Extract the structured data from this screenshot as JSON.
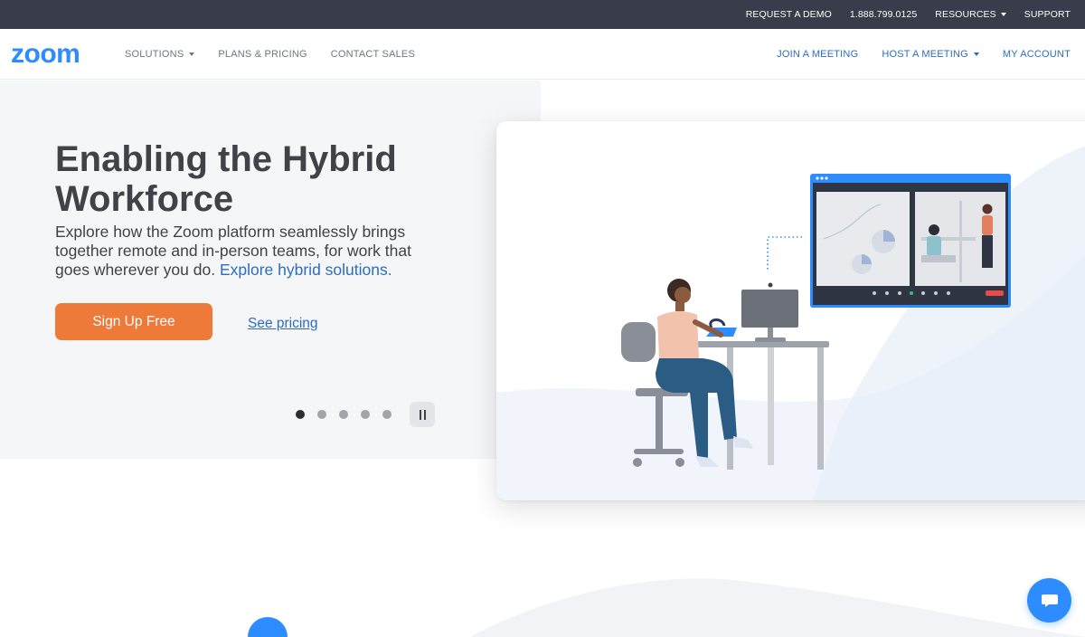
{
  "topbar": {
    "request_demo": "REQUEST A DEMO",
    "phone": "1.888.799.0125",
    "resources": "RESOURCES",
    "support": "SUPPORT"
  },
  "nav": {
    "logo_text": "zoom",
    "solutions": "SOLUTIONS",
    "plans_pricing": "PLANS & PRICING",
    "contact_sales": "CONTACT SALES",
    "join_meeting": "JOIN A MEETING",
    "host_meeting": "HOST A MEETING",
    "my_account": "MY ACCOUNT"
  },
  "hero": {
    "title": "Enabling the Hybrid Workforce",
    "body": "Explore how the Zoom platform seamlessly brings together remote and in-person teams, for work that goes wherever you do.",
    "link": "Explore hybrid solutions.",
    "signup_label": "Sign Up Free",
    "pricing_label": "See pricing"
  },
  "carousel": {
    "slide_count": 5,
    "active_index": 0
  },
  "colors": {
    "topbar_bg": "#383c4b",
    "brand_blue": "#2d8cff",
    "link_blue": "#2d6cc0",
    "cta_orange": "#ee7a39",
    "hero_bg": "#f5f6f8"
  },
  "icons": {
    "resources_caret": "chevron-down-icon",
    "solutions_caret": "chevron-down-icon",
    "host_caret": "chevron-down-icon",
    "pause": "pause-icon",
    "chat": "chat-bubble-icon"
  }
}
